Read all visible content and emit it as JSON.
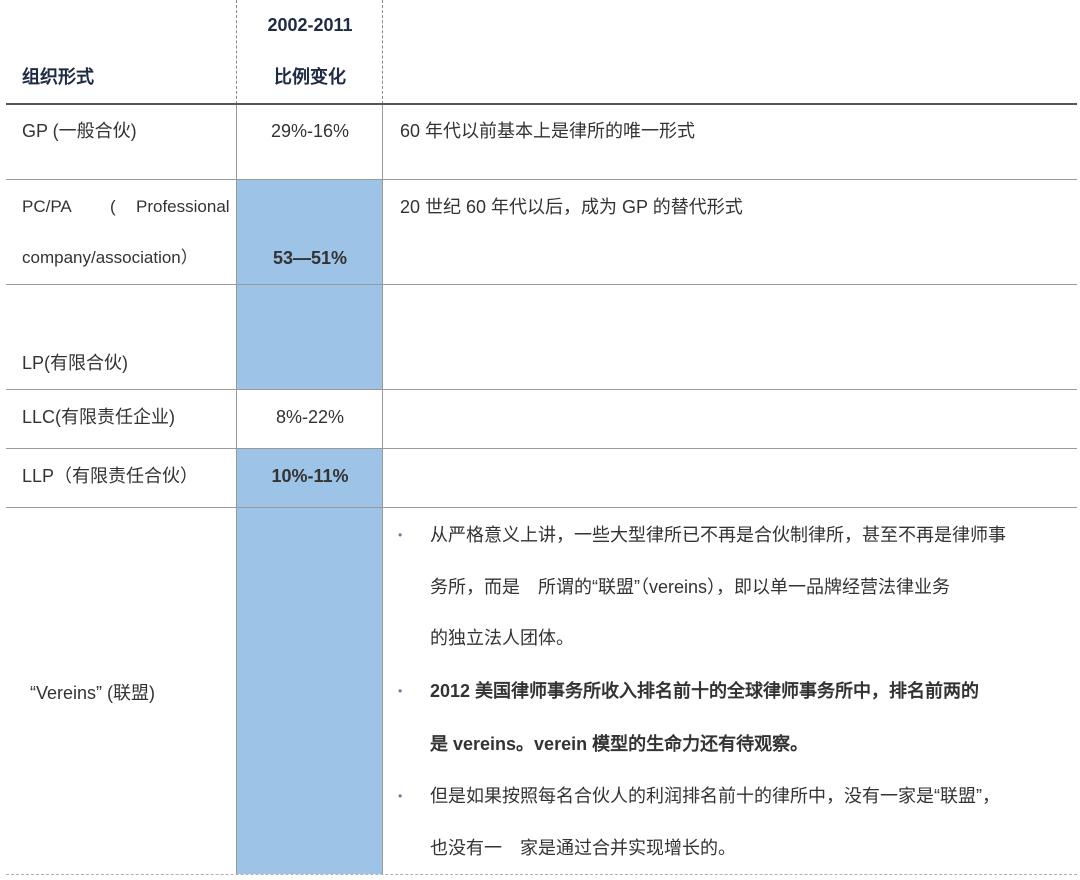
{
  "table": {
    "header": {
      "col1": "组织形式",
      "col2_line1": "2002-2011",
      "col2_line2": "比例变化"
    },
    "rows": [
      {
        "form": "GP (一般合伙)",
        "change": "29%-16%",
        "note": "60 年代以前基本上是律所的唯一形式"
      },
      {
        "form_line1": "PC/PA",
        "form_paren": "(",
        "form_word": "Professional",
        "form_line2": "company/association）",
        "change": "53—51%",
        "note": "20 世纪 60 年代以后，成为 GP 的替代形式"
      },
      {
        "form": "LP(有限合伙)",
        "change": "",
        "note": ""
      },
      {
        "form": "LLC(有限责任企业)",
        "change": "8%-22%",
        "note": ""
      },
      {
        "form": "LLP（有限责任合伙）",
        "change": "10%-11%",
        "note": ""
      },
      {
        "form": "“Vereins” (联盟)",
        "change": "",
        "bullets": [
          {
            "lines": [
              "从严格意义上讲，一些大型律所已不再是合伙制律所，甚至不再是律师事",
              "务所，而是　所谓的“联盟”（vereins），即以单一品牌经营法律业务",
              "的独立法人团体。"
            ]
          },
          {
            "lines": [
              "2012 美国律师事务所收入排名前十的全球律师事务所中，排名前两的",
              "是 vereins。verein 模型的生命力还有待观察。"
            ]
          },
          {
            "lines": [
              "但是如果按照每名合伙人的利润排名前十的律所中，没有一家是“联盟”，",
              "也没有一　家是通过合并实现增长的。"
            ]
          }
        ]
      }
    ],
    "bullet_char": "•"
  },
  "colors": {
    "highlight": "#9dc3e6",
    "header_text": "#1f2a44",
    "body_text": "#333333"
  }
}
